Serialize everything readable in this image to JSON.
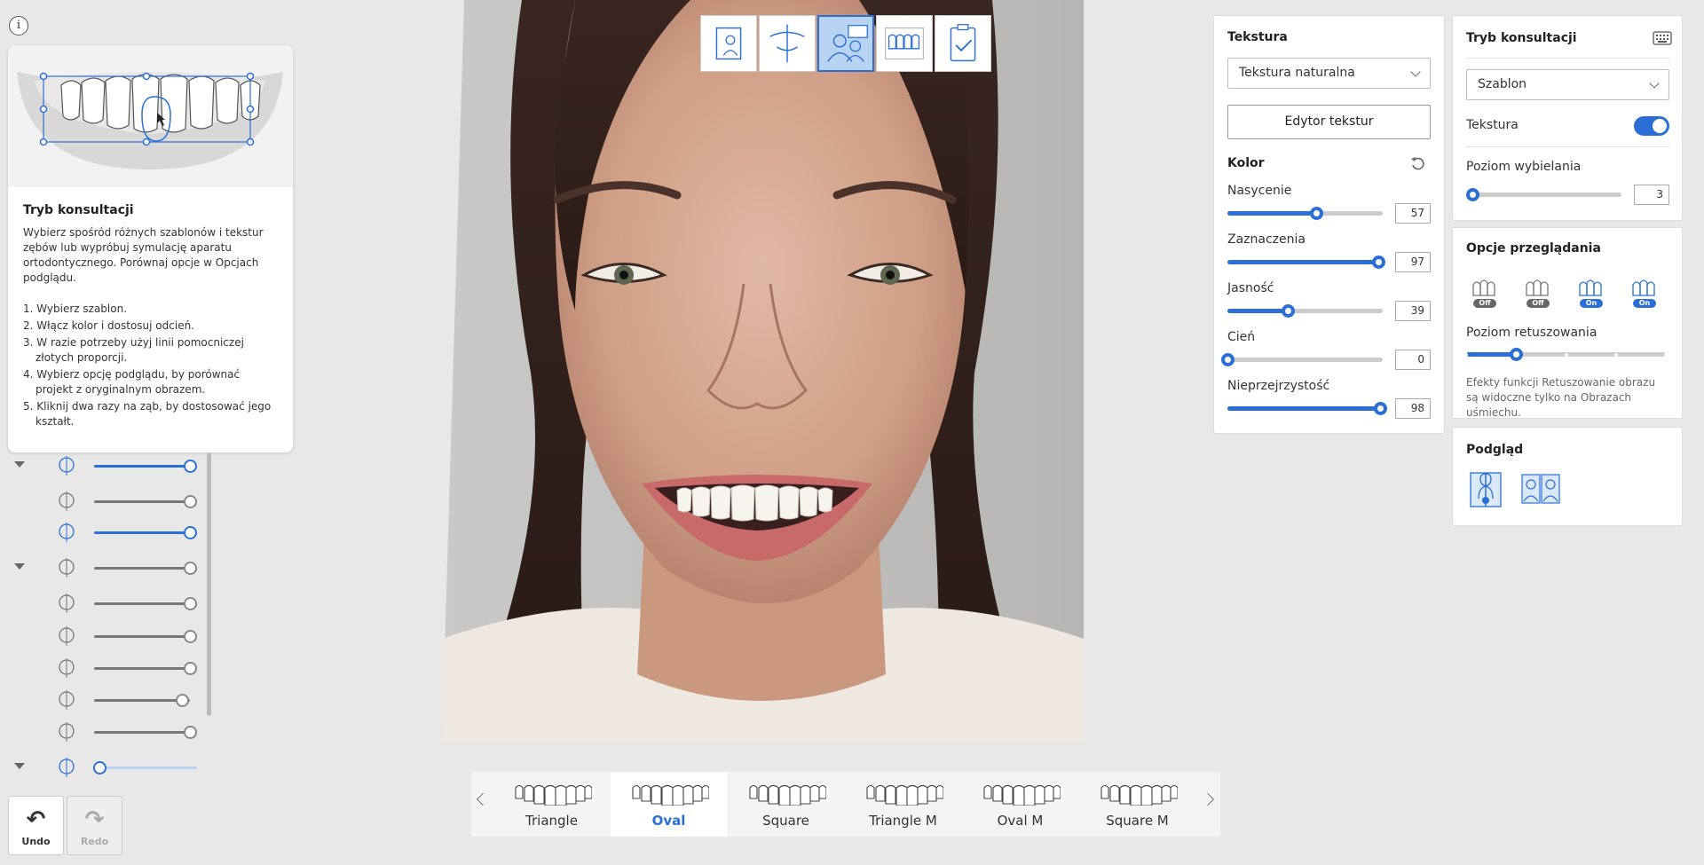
{
  "help": {
    "title": "Tryb konsultacji",
    "description": "Wybierz spośród różnych szablonów i tekstur zębów lub wypróbuj symulację aparatu ortodontycznego. Porównaj opcje w Opcjach podglądu.",
    "steps": [
      "1. Wybierz szablon.",
      "2. Włącz kolor i dostosuj odcień.",
      "3. W razie potrzeby użyj linii pomocniczej złotych proporcji.",
      "4. Wybierz opcję podglądu, by porównać projekt z oryginalnym obrazem.",
      "5. Kliknij dwa razy na ząb, by dostosować jego kształt."
    ]
  },
  "info_glyph": "i",
  "undo": {
    "label": "Undo",
    "icon": "undo-arrow-icon"
  },
  "redo": {
    "label": "Redo",
    "icon": "redo-arrow-icon"
  },
  "left_sliders": [
    {
      "icon": "face-profile-icon",
      "value": 1.0,
      "active": true,
      "caret": true
    },
    {
      "icon": "face-front-icon",
      "value": 1.0,
      "active": false,
      "caret": false
    },
    {
      "icon": "face-smile-icon",
      "value": 1.0,
      "active": true,
      "caret": false
    },
    {
      "icon": "midline-guide-icon",
      "value": 1.0,
      "active": false,
      "caret": true
    },
    {
      "icon": "vertical-line-icon",
      "value": 1.0,
      "active": false,
      "caret": false
    },
    {
      "icon": "tooth-axis-icon",
      "value": 1.0,
      "active": false,
      "caret": false
    },
    {
      "icon": "lip-line-icon",
      "value": 1.0,
      "active": false,
      "caret": false
    },
    {
      "icon": "smile-arc-icon",
      "value": 0.92,
      "active": false,
      "caret": false
    },
    {
      "icon": "tooth-width-icon",
      "value": 1.0,
      "active": false,
      "caret": false
    },
    {
      "icon": "teeth-row-icon",
      "value": 0.0,
      "active": true,
      "caret": true
    }
  ],
  "mode_buttons": [
    {
      "name": "photo-import-icon",
      "active": false
    },
    {
      "name": "alignment-guide-icon",
      "active": false
    },
    {
      "name": "consultation-mode-icon",
      "active": true
    },
    {
      "name": "teeth-library-icon",
      "active": false
    },
    {
      "name": "checklist-icon",
      "active": false
    }
  ],
  "texture_panel": {
    "title": "Tekstura",
    "select_value": "Tekstura naturalna",
    "editor_button": "Edytor tekstur",
    "color_title": "Kolor",
    "sliders": [
      {
        "label": "Nasycenie",
        "value": 57,
        "max": 100,
        "display": "57"
      },
      {
        "label": "Zaznaczenia",
        "value": 97,
        "max": 100,
        "display": "97"
      },
      {
        "label": "Jasność",
        "value": 39,
        "max": 100,
        "display": "39"
      },
      {
        "label": "Cień",
        "value": 0,
        "max": 100,
        "display": "0"
      },
      {
        "label": "Nieprzejrzystość",
        "value": 98,
        "max": 100,
        "display": "98"
      }
    ]
  },
  "consult_panel": {
    "title": "Tryb konsultacji",
    "select_value": "Szablon",
    "texture_label": "Tekstura",
    "texture_on": true,
    "whitening_label": "Poziom wybielania",
    "whitening_value": 3,
    "whitening_display": "3",
    "whitening_max": 100
  },
  "view_options": {
    "title": "Opcje przeglądania",
    "icons": [
      {
        "name": "glasses-off-icon",
        "state": "Off"
      },
      {
        "name": "braces-off-icon",
        "state": "Off"
      },
      {
        "name": "teeth-on-icon",
        "state": "On"
      },
      {
        "name": "retouch-on-icon",
        "state": "On"
      }
    ],
    "retouch_label": "Poziom retuszowania",
    "retouch_level": 1,
    "retouch_steps": 5,
    "note": "Efekty funkcji Retuszowanie obrazu są widoczne tylko na Obrazach uśmiechu."
  },
  "preview": {
    "title": "Podgląd",
    "icons": [
      "split-view-icon",
      "side-by-side-icon"
    ]
  },
  "shapes": {
    "items": [
      "Triangle",
      "Oval",
      "Square",
      "Triangle M",
      "Oval M",
      "Square M"
    ],
    "active_index": 1
  },
  "colors": {
    "accent": "#2b6fd6",
    "active_bg": "#b9d4f3"
  }
}
